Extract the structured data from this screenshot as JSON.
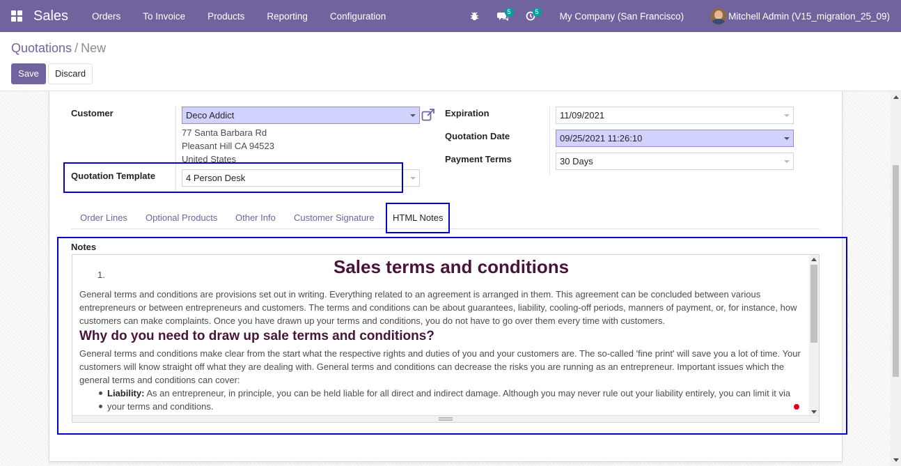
{
  "navbar": {
    "app_name": "Sales",
    "menu": [
      "Orders",
      "To Invoice",
      "Products",
      "Reporting",
      "Configuration"
    ],
    "messages_badge": "5",
    "activities_badge": "5",
    "company": "My Company (San Francisco)",
    "user": "Mitchell Admin (V15_migration_25_09)"
  },
  "breadcrumb": {
    "parent": "Quotations",
    "separator": "/",
    "current": "New"
  },
  "buttons": {
    "save": "Save",
    "discard": "Discard"
  },
  "form": {
    "customer_label": "Customer",
    "customer_value": "Deco Addict",
    "address": [
      "77 Santa Barbara Rd",
      "Pleasant Hill CA 94523",
      "United States"
    ],
    "template_label": "Quotation Template",
    "template_value": "4 Person Desk",
    "expiration_label": "Expiration",
    "expiration_value": "11/09/2021",
    "quotation_date_label": "Quotation Date",
    "quotation_date_value": "09/25/2021 11:26:10",
    "payment_terms_label": "Payment Terms",
    "payment_terms_value": "30 Days"
  },
  "tabs": [
    "Order Lines",
    "Optional Products",
    "Other Info",
    "Customer Signature",
    "HTML Notes"
  ],
  "notes": {
    "label": "Notes",
    "list_number": "1.",
    "title": "Sales terms and conditions",
    "paragraph1_lines": [
      "General terms and conditions are provisions set out in writing. Everything related to an agreement is arranged in them. This agreement can be concluded between various",
      "entrepreneurs or between entrepreneurs and customers. The terms and conditions can be about guarantees, liability, cooling-off periods, manners of payment, or, for instance, how",
      "customers can make complaints. Once you have drawn up your terms and conditions, you do not have to go over them every time with customers."
    ],
    "heading2": "Why do you need to draw up sale terms and conditions?",
    "paragraph2_lines": [
      "General terms and conditions make clear from the start what the respective rights and duties of you and your customers are. The so-called 'fine print' will save you a lot of time. Your",
      "customers will know straight off what they are dealing with. General terms and conditions can decrease the risks you are running as an entrepreneur. Important issues which the",
      "general terms and conditions can cover:"
    ],
    "bullet_bold": "Liability:",
    "bullet_lines": [
      "As an entrepreneur, in principle, you can be held liable for all direct and indirect damage. Although you may never rule out your liability entirely, you can limit it via",
      "your terms and conditions."
    ]
  },
  "colors": {
    "brand": "#71639e",
    "highlight": "#0000c8",
    "heading": "#4a1438",
    "required_field": "#d2d2ff"
  }
}
